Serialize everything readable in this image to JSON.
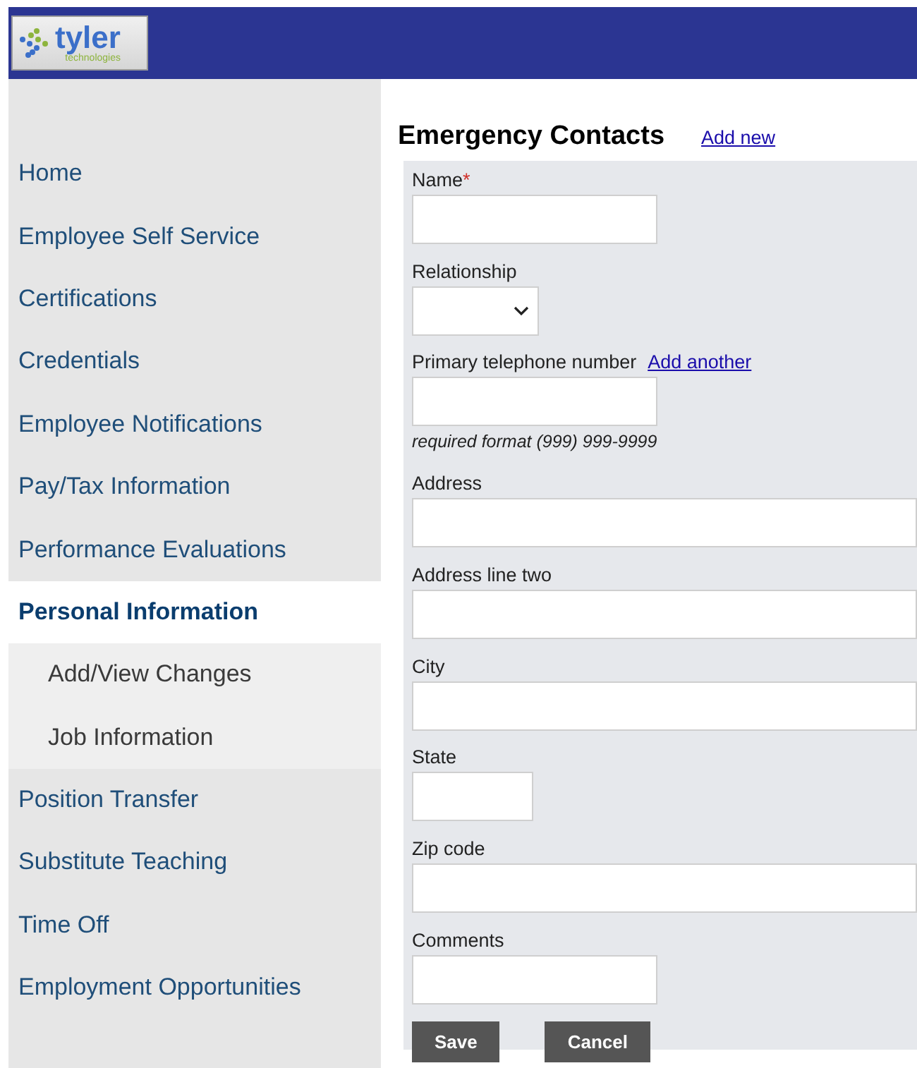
{
  "header": {
    "logo": {
      "name": "tyler",
      "tagline": "technologies"
    }
  },
  "sidebar": {
    "items": [
      {
        "label": "Home",
        "selected": false
      },
      {
        "label": "Employee Self Service",
        "selected": false
      },
      {
        "label": "Certifications",
        "selected": false
      },
      {
        "label": "Credentials",
        "selected": false
      },
      {
        "label": "Employee Notifications",
        "selected": false
      },
      {
        "label": "Pay/Tax Information",
        "selected": false
      },
      {
        "label": "Performance Evaluations",
        "selected": false
      },
      {
        "label": "Personal Information",
        "selected": true,
        "children": [
          {
            "label": "Add/View Changes",
            "selected": false
          },
          {
            "label": "Job Information",
            "selected": false
          }
        ]
      },
      {
        "label": "Position Transfer",
        "selected": false
      },
      {
        "label": "Substitute Teaching",
        "selected": false
      },
      {
        "label": "Time Off",
        "selected": false
      },
      {
        "label": "Employment Opportunities",
        "selected": false
      }
    ]
  },
  "main": {
    "title": "Emergency Contacts",
    "title_link": "Add new",
    "fields": [
      {
        "label": "Name",
        "required_mark": "*",
        "kind": "short"
      },
      {
        "label": "Relationship",
        "kind": "select"
      },
      {
        "label": "Primary telephone number",
        "kind": "short",
        "link": "Add another",
        "hint": "required format (999) 999-9999"
      },
      {
        "label": "Address",
        "kind": "wide"
      },
      {
        "label": "Address line two",
        "kind": "wide"
      },
      {
        "label": "City",
        "kind": "wide"
      },
      {
        "label": "State",
        "kind": "narrow"
      },
      {
        "label": "Zip code",
        "kind": "wide"
      },
      {
        "label": "Comments",
        "kind": "short"
      }
    ],
    "buttons": [
      "Save",
      "Cancel"
    ]
  }
}
